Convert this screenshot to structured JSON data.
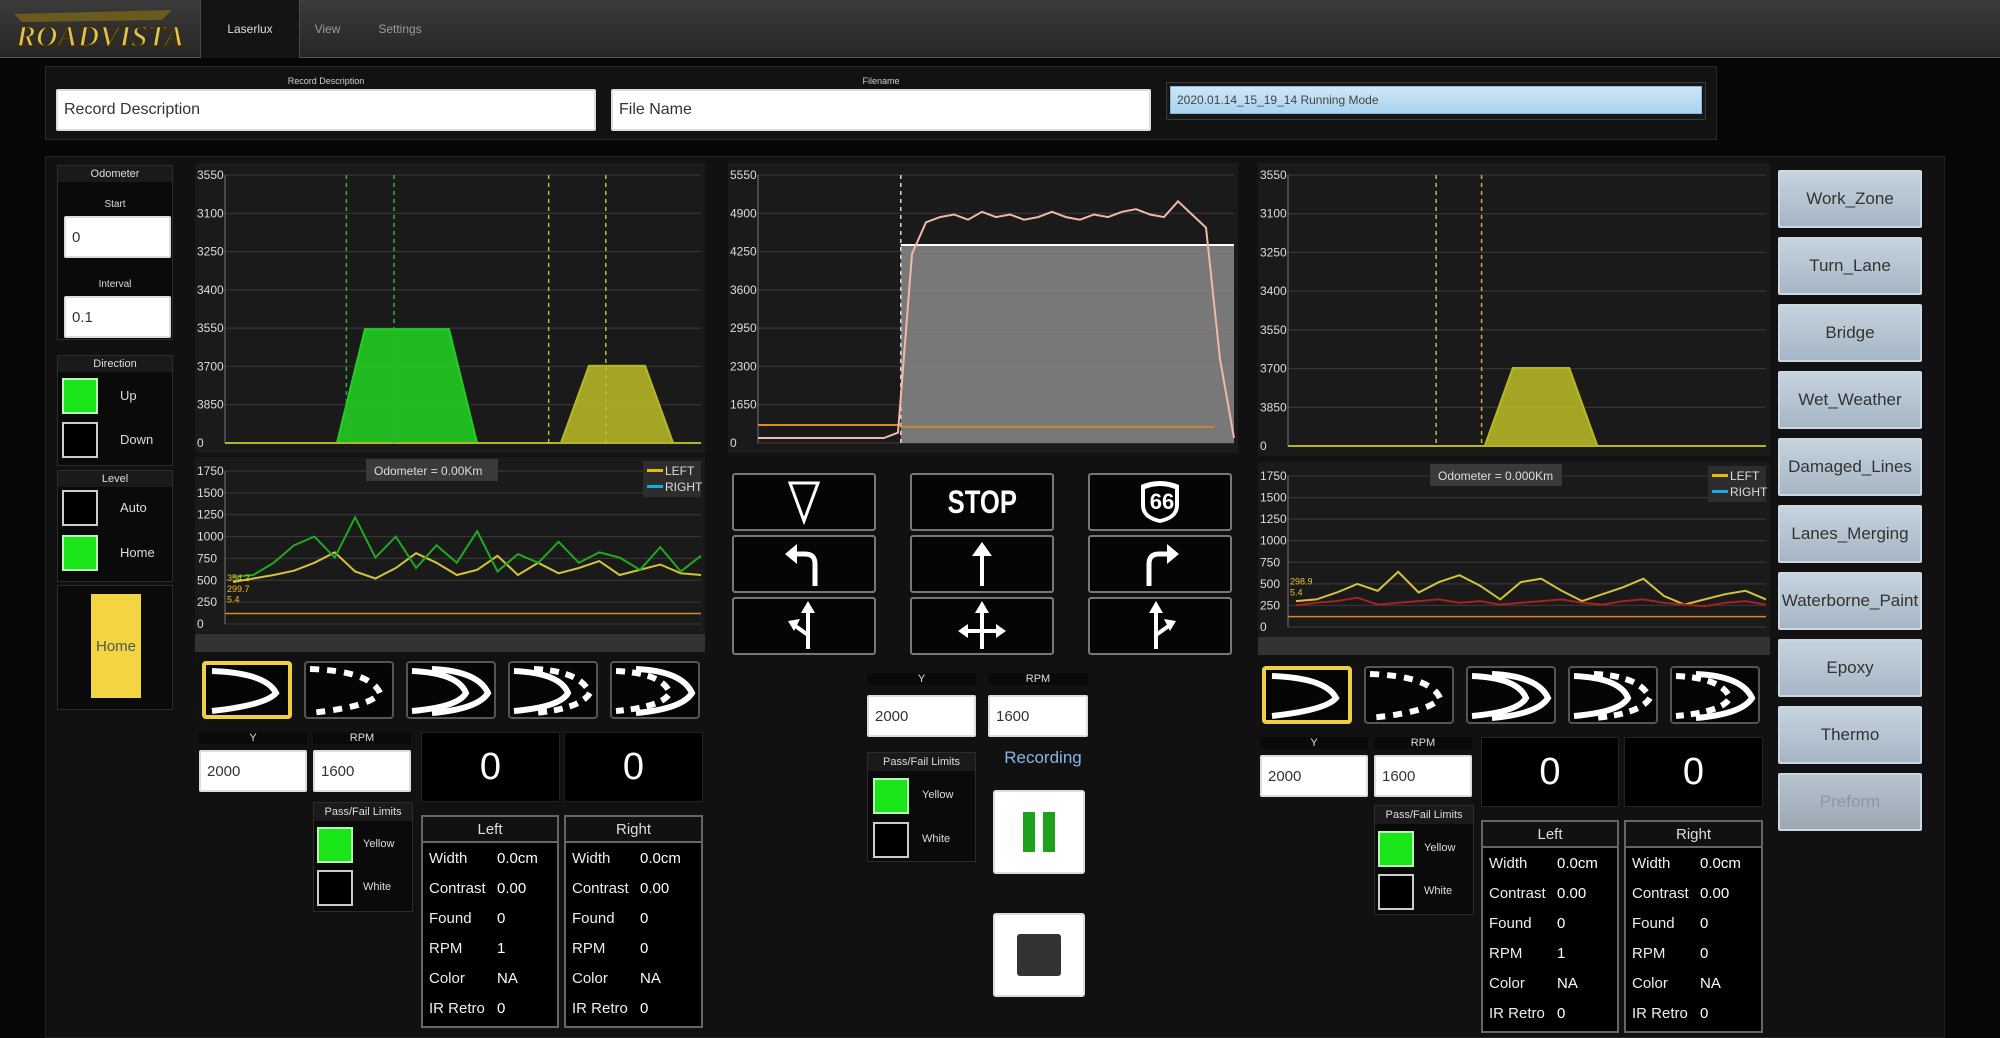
{
  "app": {
    "logo_text": "ROADVISTA"
  },
  "tabs": [
    {
      "label": "Laserlux",
      "active": true
    },
    {
      "label": "View",
      "active": false
    },
    {
      "label": "Settings",
      "active": false
    }
  ],
  "record": {
    "description_label": "Record Description",
    "description_value": "Record Description",
    "filename_label": "Filename",
    "filename_value": "File Name",
    "selected_file": "2020.01.14_15_19_14 Running Mode"
  },
  "odometer": {
    "title": "Odometer",
    "start_label": "Start",
    "start_value": "0",
    "interval_label": "Interval",
    "interval_value": "0.1"
  },
  "direction": {
    "title": "Direction",
    "up_label": "Up",
    "up_checked": true,
    "down_label": "Down",
    "down_checked": false
  },
  "level": {
    "title": "Level",
    "auto_label": "Auto",
    "auto_checked": false,
    "home_label": "Home",
    "home_checked": true
  },
  "home_button": "Home",
  "chart_data": [
    {
      "type": "line",
      "id": "left-profile",
      "ylabels": [
        "3550",
        "3100",
        "3250",
        "3400",
        "3550",
        "3700",
        "3850",
        "0"
      ],
      "series": [
        {
          "color": "#22cc22",
          "values": [
            0,
            0,
            0,
            0,
            0,
            1400,
            1400,
            1400,
            1400,
            0,
            0,
            0,
            0,
            0,
            0,
            0,
            0,
            0
          ]
        },
        {
          "color": "#b5b527",
          "values": [
            0,
            0,
            0,
            0,
            0,
            0,
            0,
            0,
            0,
            0,
            0,
            0,
            0,
            950,
            950,
            950,
            0,
            0
          ]
        }
      ]
    },
    {
      "type": "line",
      "id": "left-trend",
      "annotation": "Odometer = 0.00Km",
      "ylabels": [
        "1750",
        "1500",
        "1250",
        "1000",
        "750",
        "500",
        "250",
        "0"
      ],
      "legend": [
        "LEFT",
        "RIGHT"
      ],
      "series": [
        {
          "name": "LEFT",
          "color": "#d4c23c",
          "values": [
            480,
            520,
            560,
            610,
            700,
            820,
            600,
            520,
            640,
            810,
            700,
            560,
            620,
            780,
            560,
            700,
            580,
            640,
            720,
            560,
            620,
            680,
            580,
            560
          ]
        },
        {
          "name": "RIGHT",
          "color": "#21a821",
          "values": [
            540,
            560,
            700,
            900,
            1000,
            760,
            1220,
            760,
            1000,
            640,
            900,
            700,
            1060,
            600,
            800,
            700,
            940,
            700,
            820,
            760,
            620,
            880,
            600,
            780
          ]
        }
      ],
      "marker_labels": [
        "354.2",
        "299.7",
        "5.4"
      ]
    },
    {
      "type": "area",
      "id": "center-profile",
      "ylabels": [
        "5550",
        "4900",
        "4250",
        "3600",
        "2950",
        "2300",
        "1650",
        "0"
      ],
      "values": [
        0,
        0,
        0,
        0,
        0,
        0,
        0,
        0,
        4100,
        4100,
        4100,
        4100,
        4100,
        4100,
        4100,
        4100,
        4100,
        4100,
        0,
        0
      ]
    },
    {
      "type": "line",
      "id": "right-profile",
      "ylabels": [
        "3550",
        "3100",
        "3250",
        "3400",
        "3550",
        "3700",
        "3850",
        "0"
      ],
      "series": [
        {
          "color": "#b5b527",
          "values": [
            0,
            0,
            0,
            0,
            0,
            0,
            0,
            0,
            950,
            950,
            950,
            0,
            0,
            0,
            0,
            0,
            0,
            0
          ]
        }
      ]
    },
    {
      "type": "line",
      "id": "right-trend",
      "annotation": "Odometer = 0.000Km",
      "ylabels": [
        "1750",
        "1500",
        "1250",
        "1000",
        "750",
        "500",
        "250",
        "0"
      ],
      "legend": [
        "LEFT",
        "RIGHT"
      ],
      "series": [
        {
          "name": "LEFT",
          "color": "#d4c23c",
          "values": [
            300,
            320,
            400,
            500,
            420,
            640,
            400,
            520,
            600,
            480,
            320,
            520,
            560,
            420,
            300,
            380,
            460,
            560,
            360,
            260,
            320,
            380,
            420,
            320
          ]
        },
        {
          "name": "RIGHT",
          "color": "#a82020",
          "values": [
            250,
            280,
            300,
            340,
            260,
            280,
            300,
            320,
            280,
            300,
            260,
            280,
            300,
            320,
            280,
            260,
            300,
            320,
            280,
            260,
            240,
            280,
            300,
            260
          ]
        }
      ],
      "marker_labels": [
        "298.9",
        "5.4"
      ]
    }
  ],
  "left_panel": {
    "y_label": "Y",
    "y_value": "2000",
    "rpm_label": "RPM",
    "rpm_value": "1600",
    "count_left": "0",
    "count_right": "0",
    "passfail_title": "Pass/Fail Limits",
    "yellow_label": "Yellow",
    "yellow_checked": true,
    "white_label": "White",
    "white_checked": false,
    "table_left": {
      "title": "Left",
      "rows": [
        [
          "Width",
          "0.0cm"
        ],
        [
          "Contrast",
          "0.00"
        ],
        [
          "Found",
          "0"
        ],
        [
          "RPM",
          "1"
        ],
        [
          "Color",
          "NA"
        ],
        [
          "IR Retro",
          "0"
        ]
      ]
    },
    "table_right": {
      "title": "Right",
      "rows": [
        [
          "Width",
          "0.0cm"
        ],
        [
          "Contrast",
          "0.00"
        ],
        [
          "Found",
          "0"
        ],
        [
          "RPM",
          "0"
        ],
        [
          "Color",
          "NA"
        ],
        [
          "IR Retro",
          "0"
        ]
      ]
    }
  },
  "center_panel": {
    "y_label": "Y",
    "y_value": "2000",
    "rpm_label": "RPM",
    "rpm_value": "1600",
    "passfail_title": "Pass/Fail Limits",
    "yellow_label": "Yellow",
    "yellow_checked": true,
    "white_label": "White",
    "white_checked": false,
    "recording_label": "Recording",
    "stop_sign": "STOP",
    "route_sign": "66"
  },
  "right_panel": {
    "y_label": "Y",
    "y_value": "2000",
    "rpm_label": "RPM",
    "rpm_value": "1600",
    "count_left": "0",
    "count_right": "0",
    "passfail_title": "Pass/Fail Limits",
    "yellow_label": "Yellow",
    "yellow_checked": true,
    "white_label": "White",
    "white_checked": false,
    "table_left": {
      "title": "Left",
      "rows": [
        [
          "Width",
          "0.0cm"
        ],
        [
          "Contrast",
          "0.00"
        ],
        [
          "Found",
          "0"
        ],
        [
          "RPM",
          "1"
        ],
        [
          "Color",
          "NA"
        ],
        [
          "IR Retro",
          "0"
        ]
      ]
    },
    "table_right": {
      "title": "Right",
      "rows": [
        [
          "Width",
          "0.0cm"
        ],
        [
          "Contrast",
          "0.00"
        ],
        [
          "Found",
          "0"
        ],
        [
          "RPM",
          "0"
        ],
        [
          "Color",
          "NA"
        ],
        [
          "IR Retro",
          "0"
        ]
      ]
    }
  },
  "side_buttons": [
    {
      "label": "Work_Zone",
      "enabled": true
    },
    {
      "label": "Turn_Lane",
      "enabled": true
    },
    {
      "label": "Bridge",
      "enabled": true
    },
    {
      "label": "Wet_Weather",
      "enabled": true
    },
    {
      "label": "Damaged_Lines",
      "enabled": true
    },
    {
      "label": "Lanes_Merging",
      "enabled": true
    },
    {
      "label": "Waterborne_Paint",
      "enabled": true
    },
    {
      "label": "Epoxy",
      "enabled": true
    },
    {
      "label": "Thermo",
      "enabled": true
    },
    {
      "label": "Preform",
      "enabled": false
    }
  ],
  "colors": {
    "accent_yellow": "#f0d040",
    "check_green": "#19e519",
    "left_line": "#d4c23c",
    "right_line": "#21a821"
  }
}
